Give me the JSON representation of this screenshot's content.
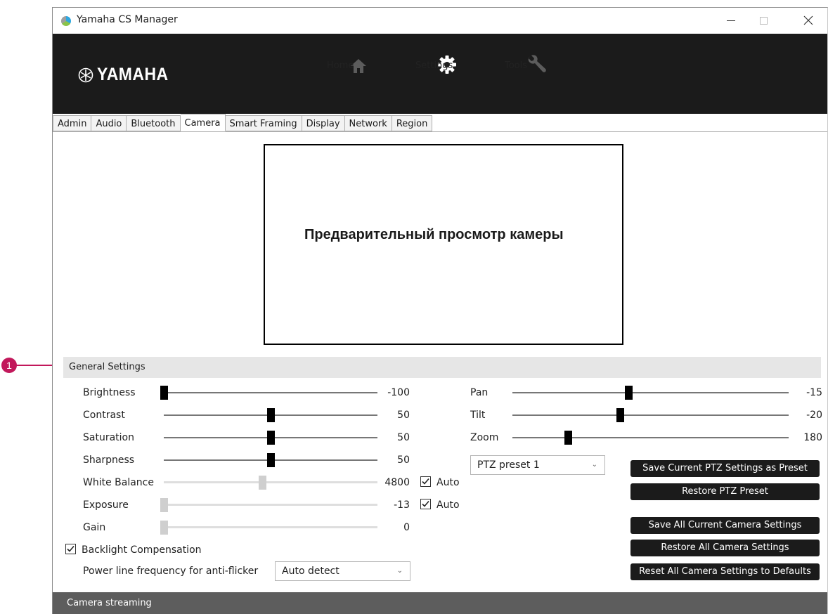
{
  "window": {
    "title": "Yamaha CS Manager"
  },
  "header": {
    "logo_text": "YAMAHA",
    "nav": [
      {
        "label": "Home",
        "icon": "home-icon",
        "active": false
      },
      {
        "label": "Settings",
        "icon": "gear-icon",
        "active": true
      },
      {
        "label": "Tools",
        "icon": "wrench-icon",
        "active": false
      }
    ]
  },
  "tabs": [
    "Admin",
    "Audio",
    "Bluetooth",
    "Camera",
    "Smart Framing",
    "Display",
    "Network",
    "Region"
  ],
  "active_tab": "Camera",
  "preview": {
    "text": "Предварительный просмотр камеры"
  },
  "general_settings": {
    "title": "General Settings",
    "sliders": [
      {
        "label": "Brightness",
        "value": "-100",
        "position": 0.0,
        "enabled": true
      },
      {
        "label": "Contrast",
        "value": "50",
        "position": 0.5,
        "enabled": true
      },
      {
        "label": "Saturation",
        "value": "50",
        "position": 0.5,
        "enabled": true
      },
      {
        "label": "Sharpness",
        "value": "50",
        "position": 0.5,
        "enabled": true
      },
      {
        "label": "White Balance",
        "value": "4800",
        "position": 0.46,
        "enabled": false,
        "auto_label": "Auto",
        "auto": true
      },
      {
        "label": "Exposure",
        "value": "-13",
        "position": 0.0,
        "enabled": false,
        "auto_label": "Auto",
        "auto": true
      },
      {
        "label": "Gain",
        "value": "0",
        "position": 0.0,
        "enabled": false
      }
    ],
    "backlight": {
      "label": "Backlight Compensation",
      "checked": true
    },
    "power_line": {
      "label": "Power line frequency for anti-flicker",
      "value": "Auto detect"
    },
    "ptz_sliders": [
      {
        "label": "Pan",
        "value": "-15",
        "position": 0.42
      },
      {
        "label": "Tilt",
        "value": "-20",
        "position": 0.39
      },
      {
        "label": "Zoom",
        "value": "180",
        "position": 0.2
      }
    ],
    "ptz_preset": {
      "value": "PTZ preset 1"
    },
    "buttons": {
      "save_ptz": "Save Current PTZ Settings as Preset",
      "restore_ptz": "Restore PTZ Preset",
      "save_all": "Save All Current Camera Settings",
      "restore_all": "Restore All Camera Settings",
      "reset_all": "Reset All Camera Settings to Defaults"
    }
  },
  "footer": {
    "title": "Camera streaming"
  },
  "callout": {
    "number": "1",
    "color": "#c2185b"
  },
  "colors": {
    "header_bg": "#1b1b1b",
    "section_bg": "#e6e6e6",
    "footer_bg": "#5d5d5d",
    "button_bg": "#1b1b1b"
  }
}
